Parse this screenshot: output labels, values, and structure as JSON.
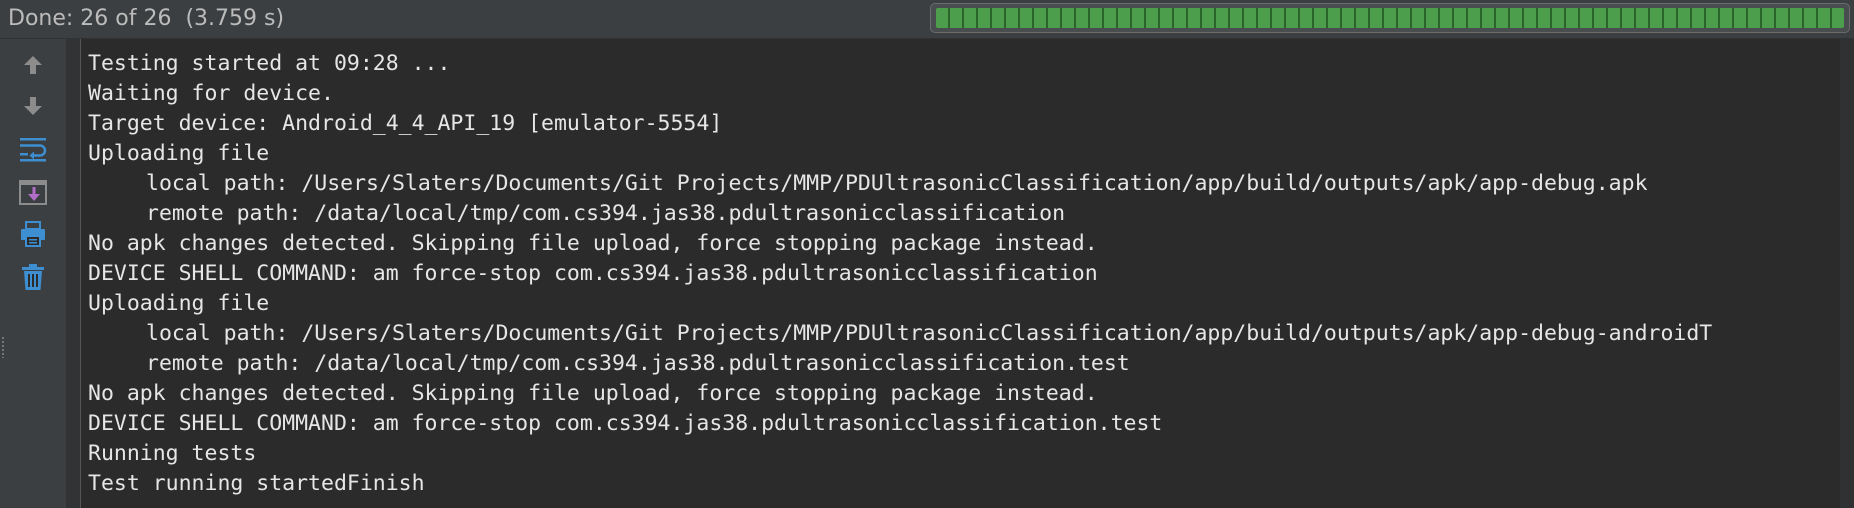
{
  "status": {
    "text": "Done: 26 of 26  (3.759 s)",
    "progress": {
      "done": 26,
      "total": 26,
      "fraction": 1.0,
      "color": "#4c9e4c"
    }
  },
  "toolbar": {
    "buttons": [
      {
        "name": "rerun-previous-test-icon",
        "label": "up arrow",
        "color": "#8c8c8c"
      },
      {
        "name": "next-test-icon",
        "label": "down arrow",
        "color": "#8c8c8c"
      },
      {
        "name": "soft-wrap-icon",
        "label": "soft wraps",
        "color": "#3d8fd1"
      },
      {
        "name": "scroll-to-end-icon",
        "label": "scroll to end",
        "color": "#b06ec9"
      },
      {
        "name": "print-icon",
        "label": "print",
        "color": "#3d8fd1"
      },
      {
        "name": "clear-all-icon",
        "label": "clear all",
        "color": "#3d8fd1"
      }
    ]
  },
  "console": {
    "lines": [
      {
        "text": "Testing started at 09:28 ...",
        "indent": false
      },
      {
        "text": "Waiting for device.",
        "indent": false
      },
      {
        "text": "Target device: Android_4_4_API_19 [emulator-5554]",
        "indent": false
      },
      {
        "text": "Uploading file",
        "indent": false
      },
      {
        "text": "local path: /Users/Slaters/Documents/Git Projects/MMP/PDUltrasonicClassification/app/build/outputs/apk/app-debug.apk",
        "indent": true
      },
      {
        "text": "remote path: /data/local/tmp/com.cs394.jas38.pdultrasonicclassification",
        "indent": true
      },
      {
        "text": "No apk changes detected. Skipping file upload, force stopping package instead.",
        "indent": false
      },
      {
        "text": "DEVICE SHELL COMMAND: am force-stop com.cs394.jas38.pdultrasonicclassification",
        "indent": false
      },
      {
        "text": "Uploading file",
        "indent": false
      },
      {
        "text": "local path: /Users/Slaters/Documents/Git Projects/MMP/PDUltrasonicClassification/app/build/outputs/apk/app-debug-androidT",
        "indent": true
      },
      {
        "text": "remote path: /data/local/tmp/com.cs394.jas38.pdultrasonicclassification.test",
        "indent": true
      },
      {
        "text": "No apk changes detected. Skipping file upload, force stopping package instead.",
        "indent": false
      },
      {
        "text": "DEVICE SHELL COMMAND: am force-stop com.cs394.jas38.pdultrasonicclassification.test",
        "indent": false
      },
      {
        "text": "Running tests",
        "indent": false
      },
      {
        "text": "Test running startedFinish",
        "indent": false
      }
    ]
  }
}
